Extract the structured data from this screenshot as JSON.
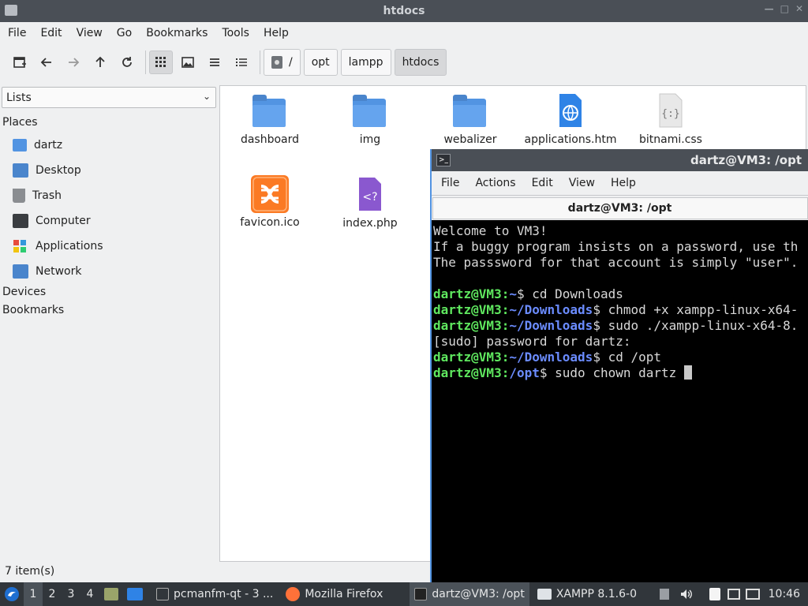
{
  "file_manager": {
    "title": "htdocs",
    "menu": [
      "File",
      "Edit",
      "View",
      "Go",
      "Bookmarks",
      "Tools",
      "Help"
    ],
    "breadcrumb": [
      "/",
      "opt",
      "lampp",
      "htdocs"
    ],
    "side_panel": {
      "selector": "Lists",
      "places_header": "Places",
      "places": [
        "dartz",
        "Desktop",
        "Trash",
        "Computer",
        "Applications",
        "Network"
      ],
      "devices_header": "Devices",
      "bookmarks_header": "Bookmarks"
    },
    "files": [
      "dashboard",
      "img",
      "webalizer",
      "applications.htm",
      "bitnami.css",
      "favicon.ico",
      "index.php"
    ],
    "status": "7 item(s)"
  },
  "terminal": {
    "title": "dartz@VM3: /opt",
    "menu": [
      "File",
      "Actions",
      "Edit",
      "View",
      "Help"
    ],
    "tab_label": "dartz@VM3: /opt",
    "lines": {
      "l1": "Welcome to VM3!",
      "l2": "If a buggy program insists on a password, use th",
      "l3": "The passsword for that account is simply \"user\".",
      "p4_user": "dartz@VM3",
      "p4_path": "~",
      "p4_cmd": " cd Downloads",
      "p5_user": "dartz@VM3",
      "p5_path": "~/Downloads",
      "p5_cmd": " chmod +x xampp-linux-x64-",
      "p6_user": "dartz@VM3",
      "p6_path": "~/Downloads",
      "p6_cmd": " sudo ./xampp-linux-x64-8.",
      "l7": "[sudo] password for dartz:",
      "p8_user": "dartz@VM3",
      "p8_path": "~/Downloads",
      "p8_cmd": " cd /opt",
      "p9_user": "dartz@VM3",
      "p9_path": "/opt",
      "p9_cmd": " sudo chown dartz "
    }
  },
  "taskbar": {
    "desktops": [
      "1",
      "2",
      "3",
      "4"
    ],
    "tasks": [
      "pcmanfm-qt - 3 ...",
      "Mozilla Firefox",
      "dartz@VM3: /opt",
      "XAMPP 8.1.6-0"
    ],
    "clock": "10:46"
  },
  "colors": {
    "prompt_user": "#5fe85f",
    "prompt_path": "#6b8cff",
    "folder": "#5294e2",
    "taskbar": "#31363b"
  }
}
